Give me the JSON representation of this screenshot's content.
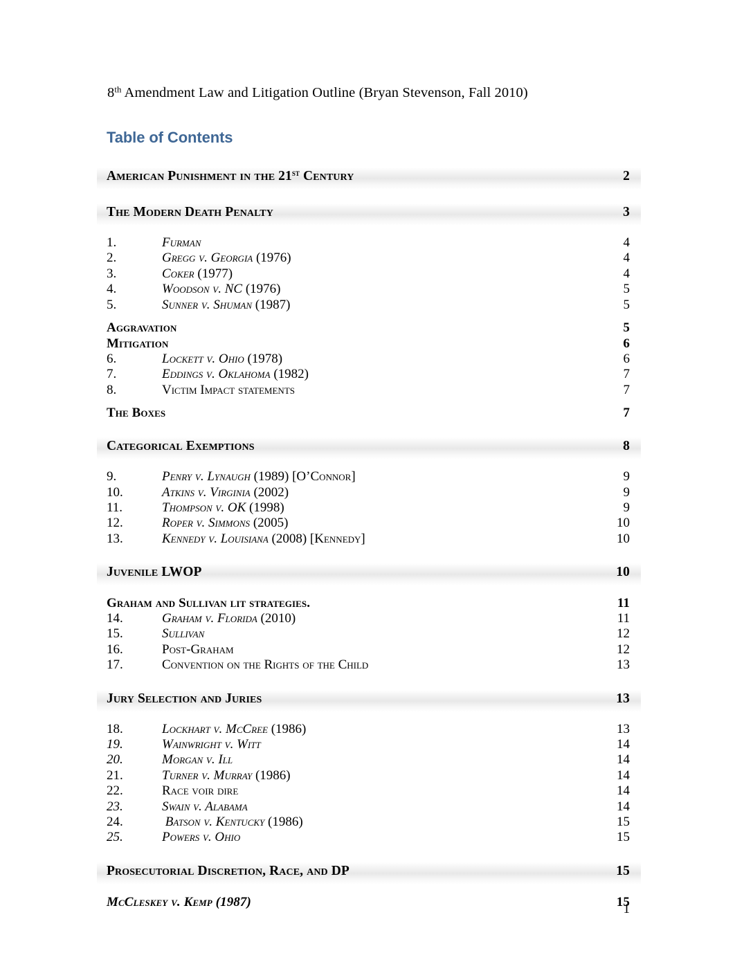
{
  "header": {
    "prefix": "8",
    "sup": "th",
    "rest": " Amendment Law and Litigation Outline (Bryan Stevenson, Fall 2010)"
  },
  "toc_title": "Table of Contents",
  "footer": {
    "page_number": "1"
  },
  "colors": {
    "heading_blue": "#3f6795",
    "text": "#000000",
    "band": "#e4e4e4"
  },
  "entries": [
    {
      "level": 1,
      "label_pre": "American Punishment in the 21",
      "sup": "st",
      "label_post": " Century",
      "page": "2"
    },
    {
      "level": 1,
      "label": "The Modern Death Penalty",
      "page": "3"
    },
    {
      "level": 3,
      "num": "1.",
      "case": "Furman",
      "suffix": "",
      "page": "4"
    },
    {
      "level": 3,
      "num": "2.",
      "case": "Gregg v. Georgia",
      "suffix": " (1976)",
      "page": "4"
    },
    {
      "level": 3,
      "num": "3.",
      "case": "Coker",
      "suffix": " (1977)",
      "page": "4"
    },
    {
      "level": 3,
      "num": "4.",
      "case": "Woodson v. NC",
      "suffix": " (1976)",
      "page": "5"
    },
    {
      "level": 3,
      "num": "5.",
      "case": "Sunner v. Shuman",
      "suffix": " (1987)",
      "page": "5"
    },
    {
      "level": 2,
      "label": "Aggravation",
      "page": "5"
    },
    {
      "level": 2,
      "label": "Mitigation",
      "page": "6"
    },
    {
      "level": 3,
      "num": "6.",
      "case": "Lockett v. Ohio",
      "suffix": " (1978)",
      "page": "6"
    },
    {
      "level": 3,
      "num": "7.",
      "case": "Eddings v. Oklahoma",
      "suffix": " (1982)",
      "page": "7"
    },
    {
      "level": 3,
      "num": "8.",
      "upright": "Victim Impact statements",
      "page": "7"
    },
    {
      "level": 2,
      "label": "The Boxes",
      "page": "7"
    },
    {
      "level": 1,
      "label": "Categorical Exemptions",
      "page": "8"
    },
    {
      "level": 3,
      "num": "9.",
      "case": "Penry v. Lynaugh",
      "suffix": " (1989) ",
      "sc_tail": "[O’Connor]",
      "page": "9"
    },
    {
      "level": 3,
      "num": "10.",
      "case": "Atkins v. Virginia",
      "suffix": "  (2002)",
      "page": "9"
    },
    {
      "level": 3,
      "num": "11.",
      "case": "Thompson v. OK",
      "suffix": " (1998)",
      "page": "9"
    },
    {
      "level": 3,
      "num": "12.",
      "case": "Roper v. Simmons",
      "suffix": " (2005)",
      "page": "10"
    },
    {
      "level": 3,
      "num": "13.",
      "case": "Kennedy v. Louisiana",
      "suffix": " (2008) ",
      "sc_tail": "[Kennedy]",
      "page": "10"
    },
    {
      "level": 1,
      "label": "Juvenile LWOP",
      "page": "10"
    },
    {
      "level": 2,
      "label": "Graham and Sullivan lit strategies.",
      "page": "11"
    },
    {
      "level": 3,
      "num": "14.",
      "case": "Graham v. Florida",
      "suffix": " (2010)",
      "page": "11"
    },
    {
      "level": 3,
      "num": "15.",
      "case": "Sullivan",
      "suffix": "",
      "page": "12"
    },
    {
      "level": 3,
      "num": "16.",
      "upright": "Post-Graham",
      "page": "12"
    },
    {
      "level": 3,
      "num": "17.",
      "upright": "Convention on the Rights of the Child",
      "page": "13"
    },
    {
      "level": 1,
      "label": "Jury Selection and Juries",
      "page": "13"
    },
    {
      "level": 3,
      "num": "18.",
      "case": "Lockhart v. McCree",
      "suffix": " (1986)",
      "page": "13"
    },
    {
      "level": 3,
      "num": "19.",
      "num_italic": true,
      "case": "Wainwright v. Witt",
      "suffix": "",
      "page": "14"
    },
    {
      "level": 3,
      "num": "20.",
      "num_italic": true,
      "case": "Morgan v. Ill",
      "suffix": "",
      "page": "14"
    },
    {
      "level": 3,
      "num": "21.",
      "case": "Turner v. Murray",
      "suffix": " (1986)",
      "page": "14"
    },
    {
      "level": 3,
      "num": "22.",
      "upright": "Race voir dire",
      "page": "14"
    },
    {
      "level": 3,
      "num": "23.",
      "num_italic": true,
      "case": "Swain v. Alabama",
      "suffix": "",
      "page": "14"
    },
    {
      "level": 3,
      "num": "24.",
      "case": " Batson v. Kentucky",
      "suffix": "  (1986)",
      "page": "15"
    },
    {
      "level": 3,
      "num": "25.",
      "num_italic": true,
      "case": "Powers v. Ohio",
      "suffix": "",
      "page": "15"
    },
    {
      "level": 1,
      "label": "Prosecutorial Discretion, Race, and DP",
      "page": "15"
    },
    {
      "level": 2,
      "italic": true,
      "case": "McCleskey v. Kemp",
      "suffix": " (1987)",
      "page": "15"
    }
  ]
}
